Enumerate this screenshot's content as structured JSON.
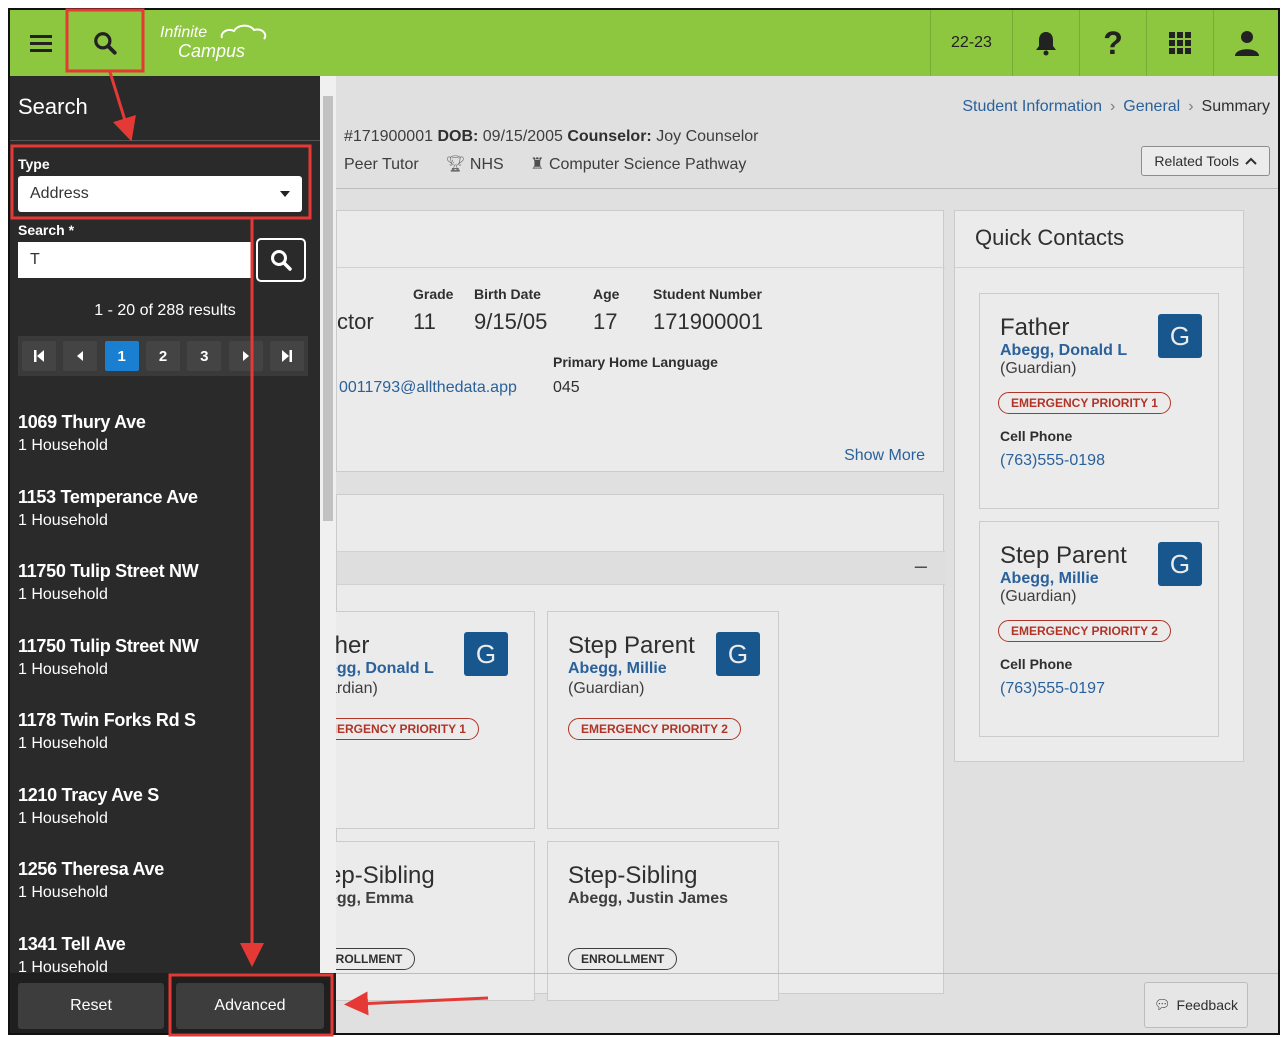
{
  "topbar": {
    "logo_line1": "Infinite",
    "logo_line2": "Campus",
    "school_year": "22-23"
  },
  "breadcrumb": {
    "items": [
      "Student Information",
      "General",
      "Summary"
    ]
  },
  "student_header": {
    "id": "#171900001",
    "dob_label": "DOB:",
    "dob": "09/15/2005",
    "counselor_label": "Counselor:",
    "counselor": "Joy Counselor",
    "flag_peer": "Peer Tutor",
    "flag_nhs": "NHS",
    "flag_pathway": "Computer Science Pathway",
    "related_tools": "Related Tools"
  },
  "summary_card": {
    "name_fragment": "ctor",
    "grade_label": "Grade",
    "grade": "11",
    "birth_label": "Birth Date",
    "birth": "9/15/05",
    "age_label": "Age",
    "age": "17",
    "number_label": "Student Number",
    "number": "171900001",
    "lang_label": "Primary Home Language",
    "lang": "045",
    "email_fragment": "0011793@allthedata.app",
    "show_more": "Show More"
  },
  "household_cards": [
    {
      "title": "ther",
      "name": "egg, Donald L",
      "role": "ardian)",
      "badge": "MERGENCY PRIORITY 1",
      "g": "G"
    },
    {
      "title": "Step Parent",
      "name": "Abegg, Millie",
      "role": "(Guardian)",
      "badge": "EMERGENCY PRIORITY 2",
      "g": "G"
    },
    {
      "title": "ep-Sibling",
      "name": "egg, Emma",
      "badge": "NROLLMENT"
    },
    {
      "title": "Step-Sibling",
      "name": "Abegg, Justin James",
      "badge": "ENROLLMENT"
    }
  ],
  "collapse_symbol": "–",
  "quick_contacts": {
    "title": "Quick Contacts",
    "contacts": [
      {
        "title": "Father",
        "name": "Abegg, Donald L",
        "role": "(Guardian)",
        "badge": "EMERGENCY PRIORITY 1",
        "phone_label": "Cell Phone",
        "phone": "(763)555-0198",
        "g": "G"
      },
      {
        "title": "Step Parent",
        "name": "Abegg, Millie",
        "role": "(Guardian)",
        "badge": "EMERGENCY PRIORITY 2",
        "phone_label": "Cell Phone",
        "phone": "(763)555-0197",
        "g": "G"
      }
    ]
  },
  "search_panel": {
    "title": "Search",
    "type_label": "Type",
    "type_value": "Address",
    "search_label": "Search *",
    "search_value": "T",
    "results_text": "1 - 20 of 288 results",
    "pages": [
      "1",
      "2",
      "3"
    ],
    "results": [
      {
        "address": "1069 Thury Ave",
        "households": "1 Household"
      },
      {
        "address": "1153 Temperance Ave",
        "households": "1 Household"
      },
      {
        "address": "11750 Tulip Street NW",
        "households": "1 Household"
      },
      {
        "address": "11750 Tulip Street NW",
        "households": "1 Household"
      },
      {
        "address": "1178 Twin Forks Rd S",
        "households": "1 Household"
      },
      {
        "address": "1210 Tracy Ave S",
        "households": "1 Household"
      },
      {
        "address": "1256 Theresa Ave",
        "households": "1 Household"
      },
      {
        "address": "1341 Tell Ave",
        "households": "1 Household"
      }
    ],
    "reset_label": "Reset",
    "advanced_label": "Advanced"
  },
  "feedback_label": "Feedback",
  "colors": {
    "topbar": "#8dc63f",
    "sidebar": "#2a2a2a",
    "accent_blue": "#1b5e9b",
    "link": "#2e6aa8",
    "emergency": "#c0392b",
    "annotation": "#e53935"
  }
}
